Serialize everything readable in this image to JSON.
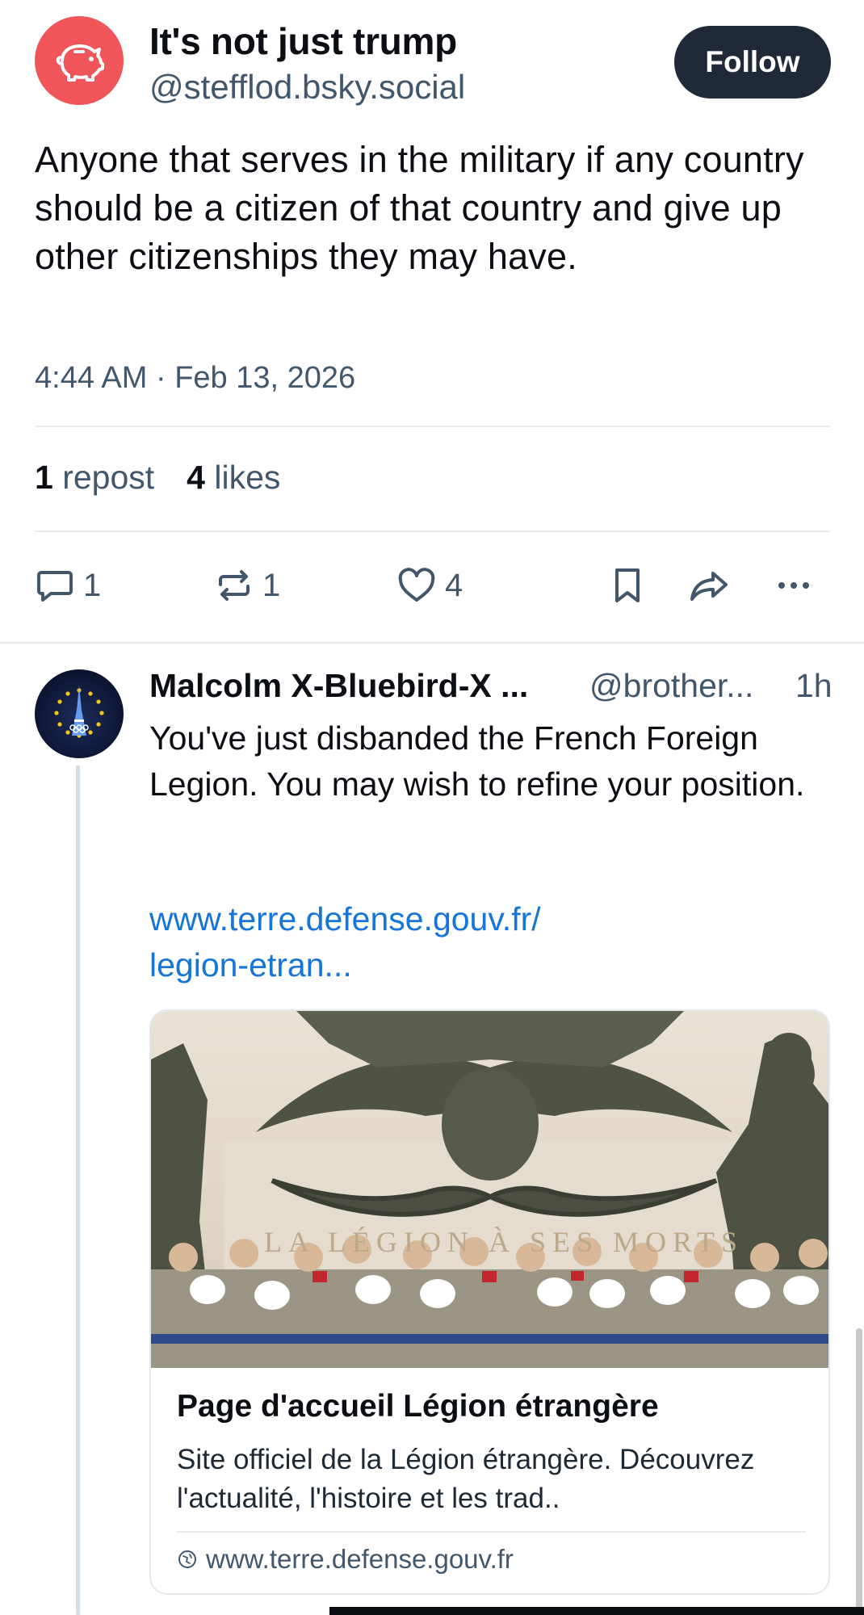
{
  "post": {
    "author_name": "It's not just trump",
    "author_handle": "@stefflod.bsky.social",
    "avatar_icon": "piggy-bank-icon",
    "avatar_color": "#f0555a",
    "follow_label": "Follow",
    "text": "Anyone that serves in the military if any country should be a citizen of that country and give up other citizenships they may have.",
    "timestamp": "4:44 AM · Feb 13, 2026",
    "stats": {
      "reposts_count": "1",
      "reposts_label": "repost",
      "likes_count": "4",
      "likes_label": "likes"
    },
    "actions": {
      "reply_count": "1",
      "repost_count": "1",
      "like_count": "4"
    }
  },
  "reply": {
    "author_name": "Malcolm X-Bluebird-X ...",
    "author_handle": "@brother...",
    "age": "1h",
    "text": "You've just disbanded the French Foreign Legion. You may wish to refine your position.",
    "link_line1": "www.terre.defense.gouv.fr/",
    "link_line2": "legion-etran...",
    "card": {
      "image_inscription": "LA LÉGION À SES MORTS",
      "title": "Page d'accueil Légion étrangère",
      "description": "Site officiel de la Légion étrangère. Découvrez l'actualité, l'histoire et les trad..",
      "domain": "www.terre.defense.gouv.fr"
    }
  },
  "colors": {
    "accent_link": "#1575d8",
    "secondary_text": "#42576c",
    "follow_bg": "#1f2937"
  }
}
